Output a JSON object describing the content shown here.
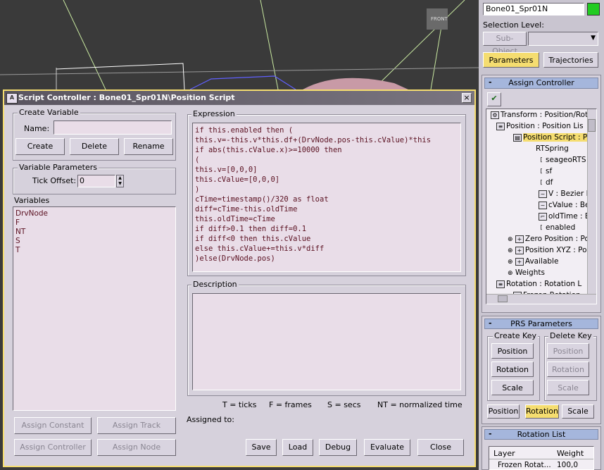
{
  "viewport": {
    "label": "FRONT"
  },
  "command_panel": {
    "object_name": "Bone01_Spr01N",
    "object_color": "#22cc22",
    "selection_level_label": "Selection Level:",
    "sub_object_button": "Sub-Object",
    "sub_object_value": "",
    "tabs": {
      "parameters": "Parameters",
      "trajectories": "Trajectories"
    },
    "assign_controller": {
      "header": "Assign Controller",
      "tree": [
        "Transform : Position/Rot",
        "Position : Position Lis",
        "Position Script : P",
        "RTSpring",
        "seageoRTS",
        "sf",
        "df",
        "V : Bezier P",
        "cValue : Be",
        "oldTime : B",
        "enabled",
        "Zero Position : Po",
        "Position XYZ : Pos",
        "Available",
        "Weights",
        "Rotation : Rotation L",
        "Frozen Rotation"
      ]
    },
    "prs": {
      "header": "PRS Parameters",
      "create_key_label": "Create Key",
      "delete_key_label": "Delete Key",
      "create": [
        "Position",
        "Rotation",
        "Scale"
      ],
      "delete": [
        "Position",
        "Rotation",
        "Scale"
      ],
      "modes": [
        "Position",
        "Rotation",
        "Scale"
      ]
    },
    "rotation_list": {
      "header": "Rotation List",
      "col_layer": "Layer",
      "col_weight": "Weight",
      "rows": [
        {
          "layer": "Frozen Rotat...",
          "weight": "100,0"
        }
      ]
    }
  },
  "dialog": {
    "title": "Script Controller : Bone01_Spr01N\\Position Script",
    "close": "×",
    "create_variable": {
      "label": "Create Variable",
      "name_label": "Name:",
      "name_value": "",
      "create": "Create",
      "delete": "Delete",
      "rename": "Rename"
    },
    "variable_parameters": {
      "label": "Variable Parameters",
      "tick_offset_label": "Tick Offset:",
      "tick_offset_value": "0"
    },
    "variables_label": "Variables",
    "variables": [
      "DrvNode",
      "F",
      "NT",
      "S",
      "T"
    ],
    "expression_label": "Expression",
    "expression": [
      "if this.enabled then (",
      "this.v=-this.v*this.df+(DrvNode.pos-this.cValue)*this",
      "if abs(this.cValue.x)>=10000 then",
      "(",
      "this.v=[0,0,0]",
      "this.cValue=[0,0,0]",
      ")",
      "cTime=timestamp()/320 as float",
      "diff=cTime-this.oldTime",
      "this.oldTime=cTime",
      "if diff>0.1 then diff=0.1",
      "if diff<0 then this.cValue",
      "else this.cValue+=this.v*diff",
      ")else(DrvNode.pos)"
    ],
    "description_label": "Description",
    "description": "",
    "legend": {
      "t": "T = ticks",
      "f": "F = frames",
      "s": "S = secs",
      "nt": "NT = normalized time"
    },
    "assigned_to_label": "Assigned to:",
    "buttons": {
      "assign_constant": "Assign Constant",
      "assign_track": "Assign Track",
      "assign_controller": "Assign Controller",
      "assign_node": "Assign Node",
      "save": "Save",
      "load": "Load",
      "debug": "Debug",
      "evaluate": "Evaluate",
      "close": "Close"
    }
  }
}
